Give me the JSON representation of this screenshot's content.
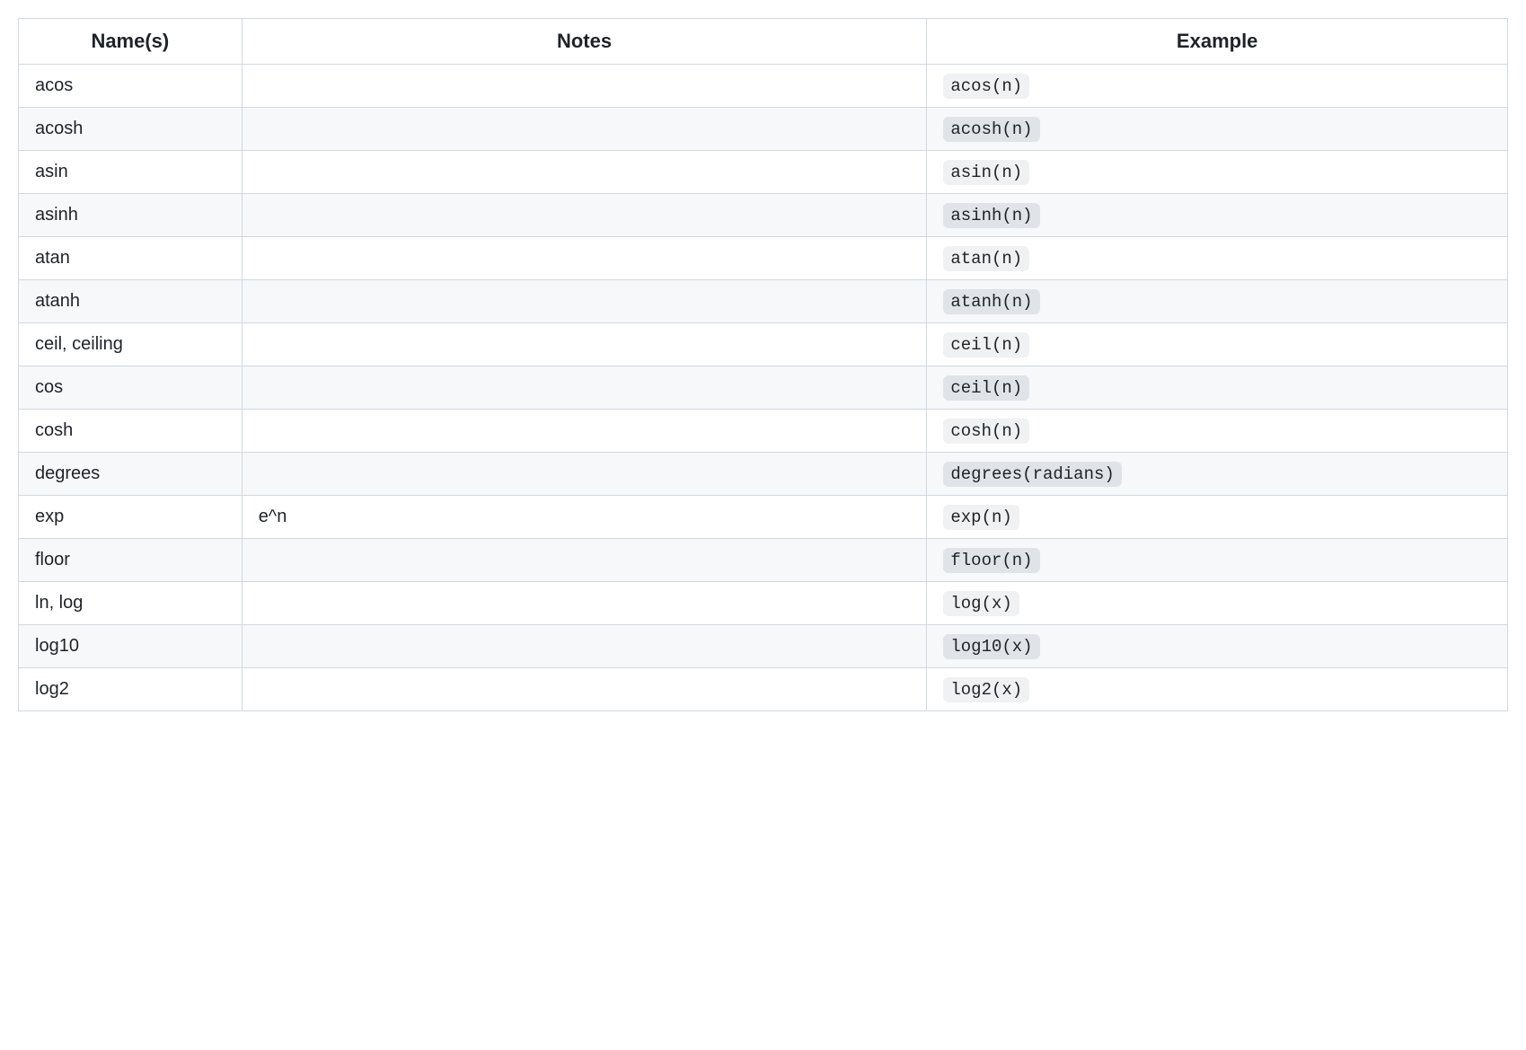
{
  "table": {
    "headers": {
      "names": "Name(s)",
      "notes": "Notes",
      "example": "Example"
    },
    "rows": [
      {
        "names": "acos",
        "notes": "",
        "example": "acos(n)"
      },
      {
        "names": "acosh",
        "notes": "",
        "example": "acosh(n)"
      },
      {
        "names": "asin",
        "notes": "",
        "example": "asin(n)"
      },
      {
        "names": "asinh",
        "notes": "",
        "example": "asinh(n)"
      },
      {
        "names": "atan",
        "notes": "",
        "example": "atan(n)"
      },
      {
        "names": "atanh",
        "notes": "",
        "example": "atanh(n)"
      },
      {
        "names": "ceil, ceiling",
        "notes": "",
        "example": "ceil(n)"
      },
      {
        "names": "cos",
        "notes": "",
        "example": "ceil(n)"
      },
      {
        "names": "cosh",
        "notes": "",
        "example": "cosh(n)"
      },
      {
        "names": "degrees",
        "notes": "",
        "example": "degrees(radians)"
      },
      {
        "names": "exp",
        "notes": "e^n",
        "example": "exp(n)"
      },
      {
        "names": "floor",
        "notes": "",
        "example": "floor(n)"
      },
      {
        "names": "ln, log",
        "notes": "",
        "example": "log(x)"
      },
      {
        "names": "log10",
        "notes": "",
        "example": "log10(x)"
      },
      {
        "names": "log2",
        "notes": "",
        "example": "log2(x)"
      }
    ]
  }
}
